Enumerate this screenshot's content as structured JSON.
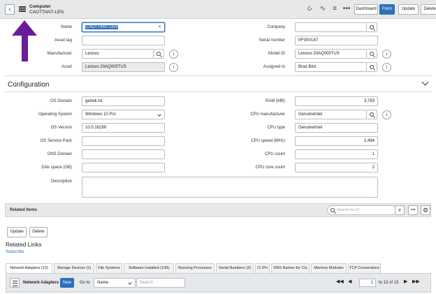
{
  "header": {
    "back_icon": "chevron-left-icon",
    "menu_icon": "hamburger-icon",
    "record_type": "Computer",
    "record_name": "CAOTTANT-LEN",
    "icons": [
      "paperclip-icon",
      "activity-icon",
      "sliders-icon",
      "more-icon"
    ],
    "buttons": {
      "dashboard": "Dashboard",
      "form": "Form",
      "update": "Update",
      "delete": "Delete"
    }
  },
  "top_form": {
    "name_label": "Name",
    "name_value": "CAOTTANT-LEN",
    "asset_tag_label": "Asset tag",
    "asset_tag_value": "",
    "manufacturer_label": "Manufacturer",
    "manufacturer_value": "Lenovo",
    "asset_label": "Asset",
    "asset_value": "Lenovo 20AQ005TUS",
    "company_label": "Company",
    "company_value": "",
    "serial_label": "Serial number",
    "serial_value": "PF00VL67",
    "model_label": "Model ID",
    "model_value": "Lenovo 20AQ005TUS",
    "assigned_label": "Assigned to",
    "assigned_value": "Brad Bird"
  },
  "configuration": {
    "title": "Configuration",
    "os_domain_label": "OS Domain",
    "os_domain_value": "gartek.tst",
    "os_label": "Operating System",
    "os_value": "Windows 10 Pro",
    "os_version_label": "OS Version",
    "os_version_value": "10.0.16299",
    "os_sp_label": "OS Service Pack",
    "os_sp_value": "",
    "dns_label": "DNS Domain",
    "dns_value": "",
    "disk_label": "Disk space (GB)",
    "disk_value": "",
    "description_label": "Description",
    "description_value": "",
    "ram_label": "RAM (MB)",
    "ram_value": "3,783",
    "cpu_mfr_label": "CPU manufacturer",
    "cpu_mfr_value": "GenuineIntel",
    "cpu_type_label": "CPU type",
    "cpu_type_value": "GenuineIntel",
    "cpu_speed_label": "CPU speed (MHz)",
    "cpu_speed_value": "2,494",
    "cpu_count_label": "CPU count",
    "cpu_count_value": "1",
    "cpu_core_label": "CPU core count",
    "cpu_core_value": "2"
  },
  "related_items": {
    "label": "Related Items",
    "search_placeholder": "Search for CI",
    "add_icon": "plus-icon",
    "tree_icon": "hierarchy-icon",
    "settings_icon": "gear-icon"
  },
  "actions": {
    "update": "Update",
    "delete": "Delete"
  },
  "related_links": {
    "title": "Related Links",
    "subscribe": "Subscribe"
  },
  "tabs": [
    "Network Adapters (13)",
    "Storage Devices (1)",
    "File Systems",
    "Software Installed (139)",
    "Running Processes",
    "Serial Numbers (2)",
    "CI IPs",
    "DNS Names for CIs",
    "Memory Modules",
    "TCP Connections"
  ],
  "list": {
    "title": "Network Adapters",
    "new_label": "New",
    "goto_label": "Go to",
    "goto_field": "Name",
    "search_placeholder": "Search",
    "page_value": "1",
    "page_of": "to 13 of 13"
  },
  "colors": {
    "accent": "#2f6fb7",
    "annotation_arrow": "#6a1b9a",
    "header_bg": "#e6e8ea"
  }
}
